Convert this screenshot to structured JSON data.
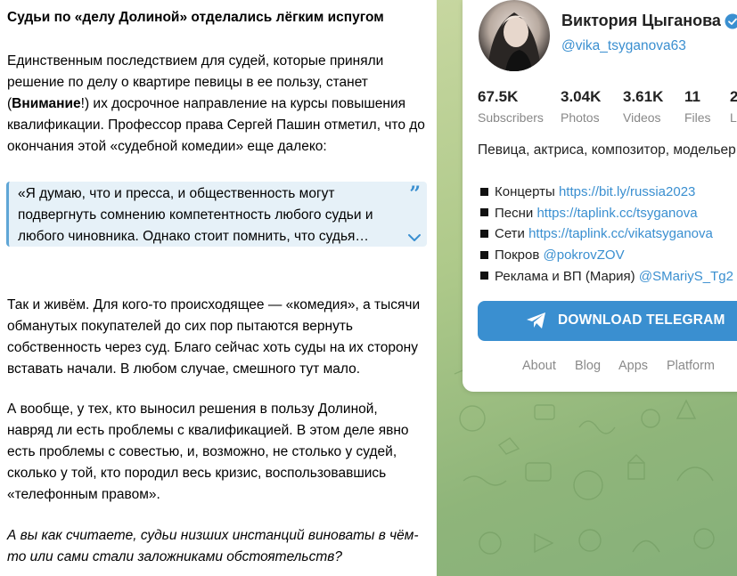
{
  "post": {
    "title": "Судьи по «делу Долиной» отделались лёгким испугом",
    "para1_a": "Единственным последствием для судей, которые приняли решение по делу о квартире певицы в ее пользу, станет (",
    "para1_bold": "Внимание",
    "para1_b": "!) их досрочное направление на курсы повышения квалификации. Профессор права Сергей Пашин отметил, что до окончания этой «судебной комедии» еще далеко:",
    "quote": "«Я думаю, что и пресса, и общественность могут подвергнуть сомнению компетентность любого судьи и любого чиновника. Однако стоит помнить, что судья…",
    "para2": "Так и живём. Для кого-то происходящее — «комедия», а тысячи обманутых покупателей до сих пор пытаются вернуть собственность через суд. Благо сейчас хоть суды на их сторону вставать начали. В любом случае, смешного тут мало.",
    "para3": "А вообще, у тех, кто выносил решения в пользу Долиной, навряд ли есть проблемы с квалификацией. В этом деле явно есть проблемы с совестью, и, возможно, не столько у судей, сколько у той, кто породил весь кризис, воспользовавшись «телефонным правом».",
    "para4": "А вы как считаете, судьи низших инстанций виноваты в чём-то или сами стали заложниками обстоятельств?"
  },
  "channel": {
    "name": "Виктория Цыганова",
    "handle": "@vika_tsyganova63",
    "stats": [
      {
        "num": "67.5K",
        "label": "Subscribers"
      },
      {
        "num": "3.04K",
        "label": "Photos"
      },
      {
        "num": "3.61K",
        "label": "Videos"
      },
      {
        "num": "11",
        "label": "Files"
      },
      {
        "num": "2",
        "label": "L"
      }
    ],
    "description": "Певица, актриса, композитор, модельер",
    "links": [
      {
        "label": "Концерты ",
        "url": "https://bit.ly/russia2023"
      },
      {
        "label": "Песни ",
        "url": "https://taplink.cc/tsyganova"
      },
      {
        "label": "Сети ",
        "url": "https://taplink.cc/vikatsyganova"
      },
      {
        "label": "Покров ",
        "url": "@pokrovZOV"
      },
      {
        "label": "Реклама и ВП (Мария) ",
        "url": "@SMariyS_Tg2"
      }
    ],
    "download_label": "DOWNLOAD TELEGRAM",
    "footer": [
      "About",
      "Blog",
      "Apps",
      "Platform"
    ]
  },
  "colors": {
    "accent": "#3a8fd0",
    "quote_bg": "#e6f1f8",
    "bg_green": "#aec98a"
  },
  "icons": [
    "quote-icon",
    "chevron-down-icon",
    "verified-icon",
    "paper-plane-icon"
  ]
}
